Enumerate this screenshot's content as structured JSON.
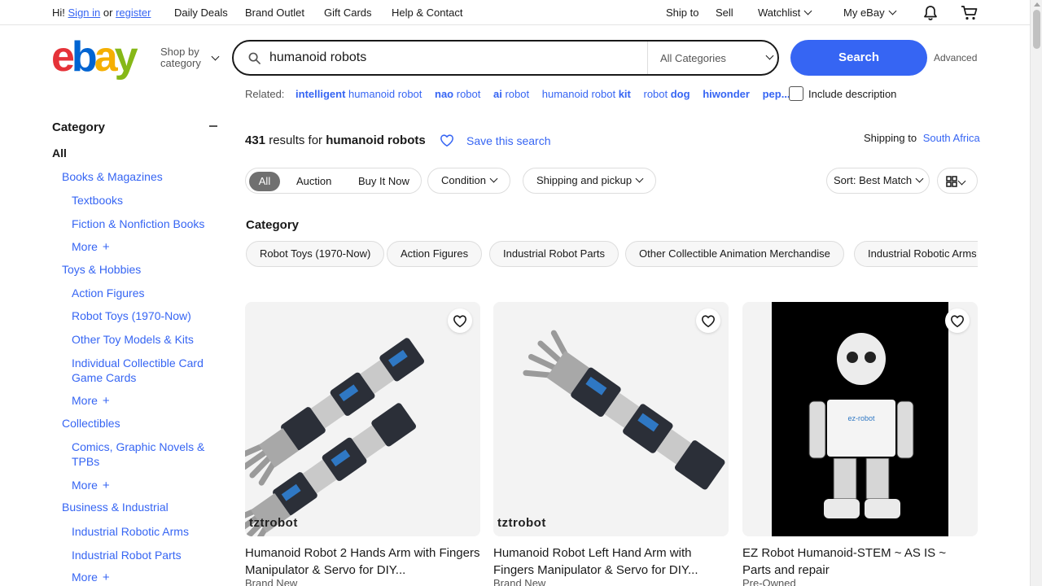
{
  "topnav": {
    "hi": "Hi!",
    "sign_in": "Sign in",
    "or": "or",
    "register": "register",
    "daily_deals": "Daily Deals",
    "brand_outlet": "Brand Outlet",
    "gift_cards": "Gift Cards",
    "help": "Help & Contact",
    "ship_to": "Ship to",
    "sell": "Sell",
    "watchlist": "Watchlist",
    "my_ebay": "My eBay"
  },
  "header": {
    "logo": [
      "e",
      "b",
      "a",
      "y"
    ],
    "shop_by_line1": "Shop by",
    "shop_by_line2": "category",
    "search_value": "humanoid robots",
    "category_select": "All Categories",
    "search_button": "Search",
    "advanced": "Advanced"
  },
  "related": {
    "label": "Related:",
    "items": [
      {
        "bold": "intelligent",
        "rest": " humanoid robot"
      },
      {
        "bold": "nao",
        "rest": " robot"
      },
      {
        "bold": "ai",
        "rest": " robot"
      },
      {
        "bold": "",
        "rest": "humanoid robot ",
        "bold2": "kit"
      },
      {
        "bold": "",
        "rest": "robot ",
        "bold2": "dog"
      },
      {
        "bold": "hiwonder",
        "rest": ""
      },
      {
        "bold": "pep...",
        "rest": ""
      }
    ],
    "include_description": "Include description"
  },
  "sidebar": {
    "heading": "Category",
    "all": "All",
    "items": [
      {
        "label": "Books & Magazines",
        "level": 1
      },
      {
        "label": "Textbooks",
        "level": 2
      },
      {
        "label": "Fiction & Nonfiction Books",
        "level": 2
      },
      {
        "label": "More",
        "level": 2,
        "more": true
      },
      {
        "label": "Toys & Hobbies",
        "level": 1
      },
      {
        "label": "Action Figures",
        "level": 2
      },
      {
        "label": "Robot Toys (1970-Now)",
        "level": 2
      },
      {
        "label": "Other Toy Models & Kits",
        "level": 2
      },
      {
        "label": "Individual Collectible Card Game Cards",
        "level": 2
      },
      {
        "label": "More",
        "level": 2,
        "more": true
      },
      {
        "label": "Collectibles",
        "level": 1
      },
      {
        "label": "Comics, Graphic Novels & TPBs",
        "level": 2
      },
      {
        "label": "More",
        "level": 2,
        "more": true
      },
      {
        "label": "Business & Industrial",
        "level": 1
      },
      {
        "label": "Industrial Robotic Arms",
        "level": 2
      },
      {
        "label": "Industrial Robot Parts",
        "level": 2
      },
      {
        "label": "More",
        "level": 2,
        "more": true
      }
    ]
  },
  "results": {
    "count": "431",
    "results_for": "results for",
    "query": "humanoid robots",
    "save_search": "Save this search",
    "shipping_label": "Shipping to",
    "shipping_country": "South Africa"
  },
  "filters": {
    "buying_format": [
      "All",
      "Auction",
      "Buy It Now"
    ],
    "condition": "Condition",
    "shipping_pickup": "Shipping and pickup",
    "sort": "Sort: Best Match"
  },
  "category_section": {
    "title": "Category",
    "pills": [
      "Robot Toys (1970-Now)",
      "Action Figures",
      "Industrial Robot Parts",
      "Other Collectible Animation Merchandise",
      "Industrial Robotic Arms"
    ]
  },
  "listings": [
    {
      "title": "Humanoid Robot 2 Hands Arm with Fingers Manipulator & Servo for DIY...",
      "condition": "Brand New",
      "watermark": "tztrobot"
    },
    {
      "title": "Humanoid Robot Left Hand Arm with Fingers Manipulator & Servo for DIY...",
      "condition": "Brand New",
      "watermark": "tztrobot"
    },
    {
      "title": "EZ Robot Humanoid-STEM ~ AS IS ~ Parts and repair",
      "condition": "Pre-Owned",
      "watermark": "ez-robot"
    }
  ],
  "colors": {
    "accent": "#3665f3",
    "logo_e": "#e53238",
    "logo_b": "#0064d2",
    "logo_a": "#f5af02",
    "logo_y": "#86b817"
  }
}
